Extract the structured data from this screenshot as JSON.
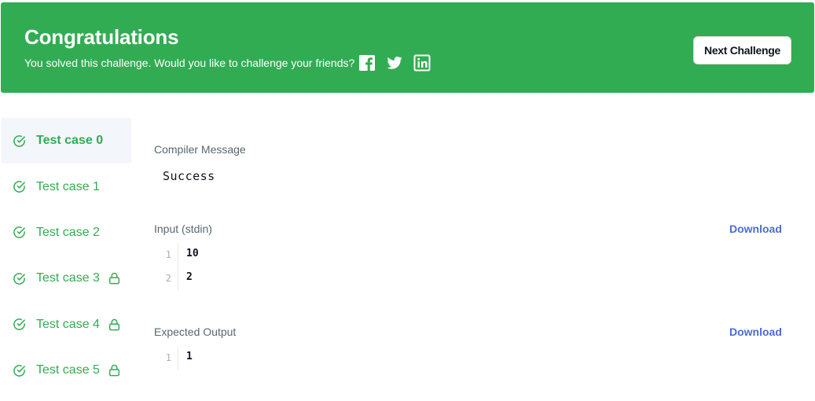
{
  "banner": {
    "title": "Congratulations",
    "subtitle": "You solved this challenge. Would you like to challenge your friends?",
    "social_icons": [
      "facebook-icon",
      "twitter-icon",
      "linkedin-icon"
    ],
    "next_button_label": "Next Challenge",
    "bg_color": "#32ac53"
  },
  "test_cases": [
    {
      "label": "Test case 0",
      "active": true,
      "locked": false
    },
    {
      "label": "Test case 1",
      "active": false,
      "locked": false
    },
    {
      "label": "Test case 2",
      "active": false,
      "locked": false
    },
    {
      "label": "Test case 3",
      "active": false,
      "locked": true
    },
    {
      "label": "Test case 4",
      "active": false,
      "locked": true
    },
    {
      "label": "Test case 5",
      "active": false,
      "locked": true
    }
  ],
  "compiler": {
    "label": "Compiler Message",
    "message": "Success"
  },
  "input": {
    "label": "Input (stdin)",
    "download_label": "Download",
    "lines": [
      {
        "num": "1",
        "text": "10"
      },
      {
        "num": "2",
        "text": "2"
      }
    ]
  },
  "expected": {
    "label": "Expected Output",
    "download_label": "Download",
    "lines": [
      {
        "num": "1",
        "text": "1"
      }
    ]
  },
  "colors": {
    "success_green": "#32ac53",
    "link_blue": "#4a6cd6",
    "active_bg": "#f3f6fa"
  }
}
